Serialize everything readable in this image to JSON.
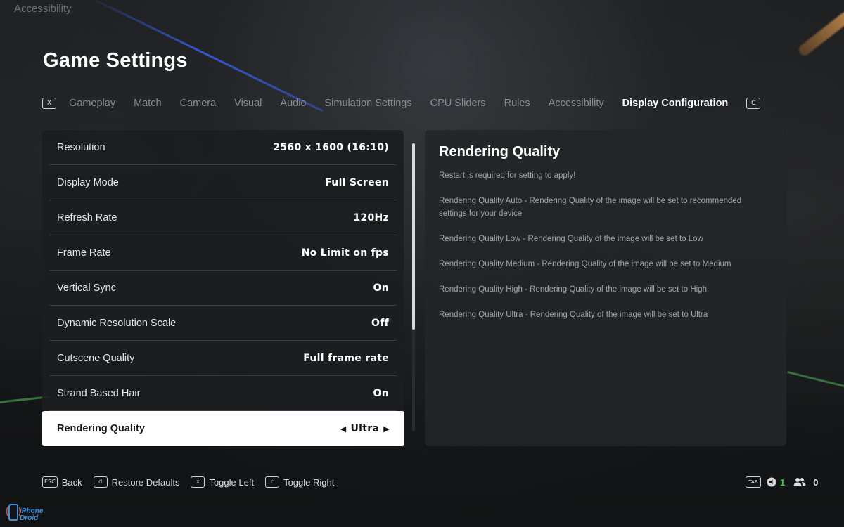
{
  "breadcrumb": "Accessibility",
  "page_title": "Game Settings",
  "tabs": {
    "left_key": "X",
    "right_key": "C",
    "items": [
      {
        "label": "Gameplay",
        "active": false
      },
      {
        "label": "Match",
        "active": false
      },
      {
        "label": "Camera",
        "active": false
      },
      {
        "label": "Visual",
        "active": false
      },
      {
        "label": "Audio",
        "active": false
      },
      {
        "label": "Simulation Settings",
        "active": false
      },
      {
        "label": "CPU Sliders",
        "active": false
      },
      {
        "label": "Rules",
        "active": false
      },
      {
        "label": "Accessibility",
        "active": false
      },
      {
        "label": "Display Configuration",
        "active": true
      }
    ]
  },
  "settings": [
    {
      "label": "Resolution",
      "value": "2560 x 1600 (16:10)"
    },
    {
      "label": "Display Mode",
      "value": "Full Screen"
    },
    {
      "label": "Refresh Rate",
      "value": "120Hz"
    },
    {
      "label": "Frame Rate",
      "value": "No Limit on fps"
    },
    {
      "label": "Vertical Sync",
      "value": "On"
    },
    {
      "label": "Dynamic Resolution Scale",
      "value": "Off"
    },
    {
      "label": "Cutscene Quality",
      "value": "Full frame rate"
    },
    {
      "label": "Strand Based Hair",
      "value": "On"
    },
    {
      "label": "Rendering Quality",
      "value": "Ultra",
      "selected": true
    }
  ],
  "description": {
    "title": "Rendering Quality",
    "lines": [
      "Restart is required for setting to apply!",
      "Rendering Quality Auto - Rendering Quality of the image will be set to recommended settings for your device",
      "Rendering Quality Low - Rendering Quality of the image will be set to Low",
      "Rendering Quality Medium - Rendering Quality of the image will be set to Medium",
      "Rendering Quality High - Rendering Quality of the image will be set to High",
      "Rendering Quality Ultra - Rendering Quality of the image will be set to Ultra"
    ]
  },
  "footer": {
    "hints": [
      {
        "key": "ESC",
        "label": "Back"
      },
      {
        "key": "d",
        "label": "Restore Defaults"
      },
      {
        "key": "x",
        "label": "Toggle Left"
      },
      {
        "key": "c",
        "label": "Toggle Right"
      }
    ],
    "tab_key": "TAB",
    "party_count": "1",
    "friends_count": "0"
  },
  "watermark": {
    "line1": "iPhone",
    "line2": "Droid"
  },
  "colors": {
    "accent_green": "#39c24a",
    "selected_row_bg": "#ffffff",
    "panel_bg": "#1c1d1f"
  }
}
